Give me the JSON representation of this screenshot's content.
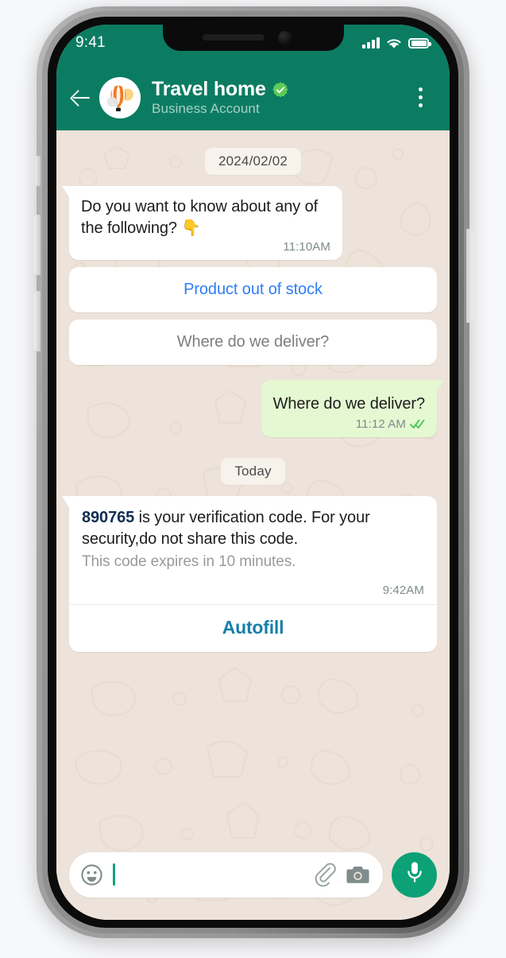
{
  "device": {
    "status_bar": {
      "time": "9:41",
      "signal_icon": "cellular-signal-icon",
      "wifi_icon": "wifi-icon",
      "battery_icon": "battery-full-icon"
    }
  },
  "header": {
    "back_icon": "back-arrow-icon",
    "avatar_icon": "hot-air-balloon-avatar",
    "contact_name": "Travel home",
    "verified_icon": "verified-badge-icon",
    "subtitle": "Business Account",
    "menu_icon": "overflow-menu-icon"
  },
  "chat": {
    "dividers": {
      "date_old": "2024/02/02",
      "date_today": "Today"
    },
    "messages": [
      {
        "id": "msg-prompt",
        "direction": "incoming",
        "text": "Do you want to know about any of the following? 👇",
        "time": "11:10AM"
      },
      {
        "id": "msg-delivery-question",
        "direction": "outgoing",
        "text": "Where do we deliver?",
        "time": "11:12 AM",
        "status_icon": "read-double-check-icon"
      }
    ],
    "quick_replies": [
      {
        "id": "reply-out-of-stock",
        "label": "Product out of stock",
        "style": "blue"
      },
      {
        "id": "reply-where-deliver",
        "label": "Where do we deliver?",
        "style": "gray"
      }
    ],
    "verification_card": {
      "code": "890765",
      "message_rest": " is your verification code. For your security,do not share this code.",
      "expiry_note": "This code expires in 10 minutes.",
      "time": "9:42AM",
      "action_label": "Autofill"
    }
  },
  "composer": {
    "emoji_icon": "emoji-smiley-icon",
    "input_value": "",
    "input_placeholder": "",
    "attach_icon": "paperclip-icon",
    "camera_icon": "camera-icon",
    "mic_icon": "microphone-icon"
  },
  "colors": {
    "header_green": "#0B7C62",
    "chat_background": "#EDE3DA",
    "outgoing_bubble": "#E4F8D2",
    "incoming_bubble": "#FFFFFF",
    "link_blue": "#2F7DF6",
    "autofill_teal": "#1A7FA8",
    "mic_green": "#0DA177",
    "code_navy": "#0F2D52"
  }
}
